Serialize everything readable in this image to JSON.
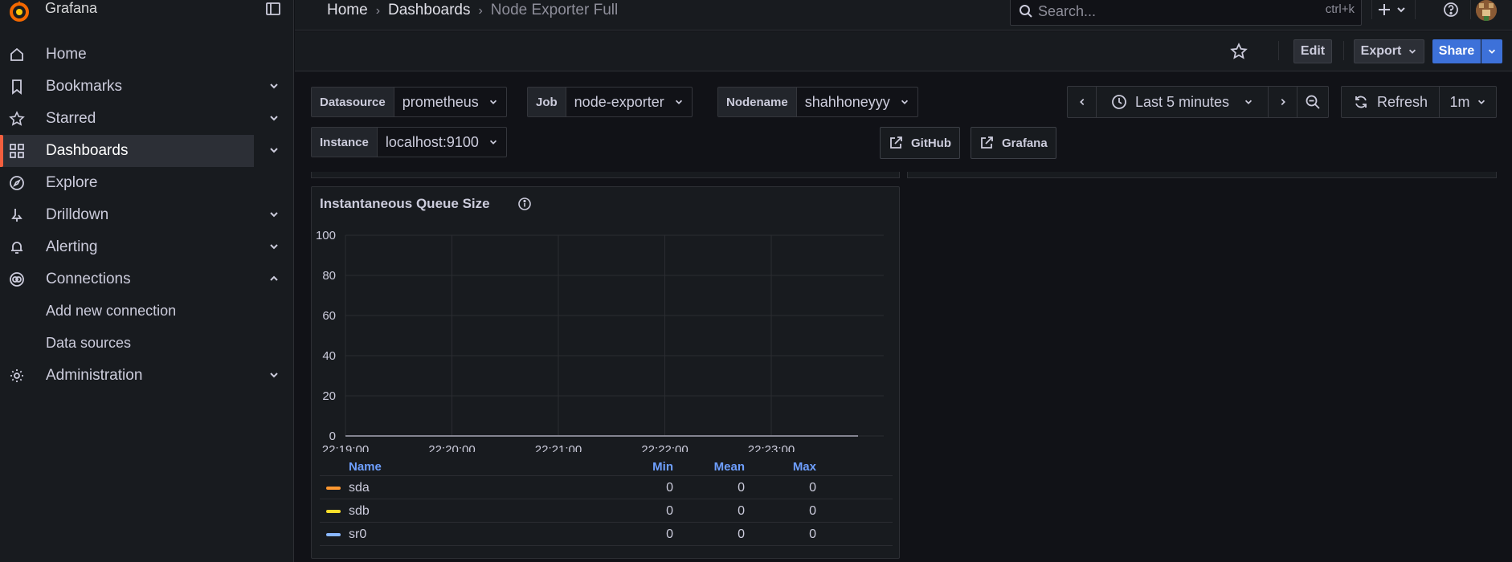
{
  "app": {
    "name": "Grafana"
  },
  "sidebar": {
    "items": [
      {
        "label": "Home",
        "icon": "home-icon"
      },
      {
        "label": "Bookmarks",
        "icon": "bookmark-icon"
      },
      {
        "label": "Starred",
        "icon": "star-icon"
      },
      {
        "label": "Dashboards",
        "icon": "apps-icon"
      },
      {
        "label": "Explore",
        "icon": "compass-icon"
      },
      {
        "label": "Drilldown",
        "icon": "drilldown-icon"
      },
      {
        "label": "Alerting",
        "icon": "bell-icon"
      },
      {
        "label": "Connections",
        "icon": "plug-icon"
      },
      {
        "label": "Add new connection"
      },
      {
        "label": "Data sources"
      },
      {
        "label": "Administration",
        "icon": "cog-icon"
      }
    ],
    "active": "Dashboards"
  },
  "topbar": {
    "breadcrumb": [
      "Home",
      "Dashboards",
      "Node Exporter Full"
    ],
    "search_placeholder": "Search...",
    "search_shortcut": "ctrl+k"
  },
  "toolbar": {
    "edit": "Edit",
    "export": "Export",
    "share": "Share"
  },
  "variables": {
    "datasource": {
      "label": "Datasource",
      "value": "prometheus"
    },
    "job": {
      "label": "Job",
      "value": "node-exporter"
    },
    "nodename": {
      "label": "Nodename",
      "value": "shahhoneyyy"
    },
    "instance": {
      "label": "Instance",
      "value": "localhost:9100"
    }
  },
  "links": {
    "github": "GitHub",
    "grafana": "Grafana"
  },
  "time": {
    "range": "Last 5 minutes",
    "refresh": "Refresh",
    "interval": "1m"
  },
  "colors": {
    "accent": "#f55f3e",
    "primary": "#3d71d9",
    "sda": "#ff9830",
    "sdb": "#fade2a",
    "sr0": "#8ab8ff"
  },
  "panel": {
    "title": "Instantaneous Queue Size"
  },
  "chart_data": {
    "type": "line",
    "title": "Instantaneous Queue Size",
    "x": [
      "22:19:00",
      "22:20:00",
      "22:21:00",
      "22:22:00",
      "22:23:00"
    ],
    "ylim": [
      0,
      100
    ],
    "yticks": [
      0,
      20,
      40,
      60,
      80,
      100
    ],
    "grid": true,
    "series": [
      {
        "name": "sda",
        "color": "#ff9830",
        "values": [
          0,
          0,
          0,
          0,
          0
        ]
      },
      {
        "name": "sdb",
        "color": "#fade2a",
        "values": [
          0,
          0,
          0,
          0,
          0
        ]
      },
      {
        "name": "sr0",
        "color": "#8ab8ff",
        "values": [
          0,
          0,
          0,
          0,
          0
        ]
      }
    ],
    "legend": {
      "columns": [
        "Name",
        "Min",
        "Mean",
        "Max"
      ],
      "rows": [
        {
          "name": "sda",
          "min": "0",
          "mean": "0",
          "max": "0"
        },
        {
          "name": "sdb",
          "min": "0",
          "mean": "0",
          "max": "0"
        },
        {
          "name": "sr0",
          "min": "0",
          "mean": "0",
          "max": "0"
        }
      ]
    }
  }
}
